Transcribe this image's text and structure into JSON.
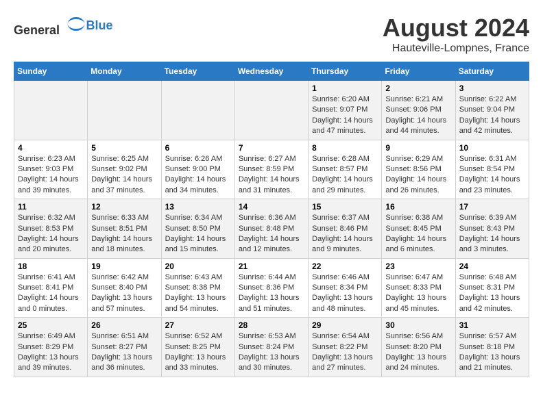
{
  "header": {
    "logo_general": "General",
    "logo_blue": "Blue",
    "month_year": "August 2024",
    "location": "Hauteville-Lompnes, France"
  },
  "days_of_week": [
    "Sunday",
    "Monday",
    "Tuesday",
    "Wednesday",
    "Thursday",
    "Friday",
    "Saturday"
  ],
  "weeks": [
    [
      {
        "day": "",
        "info": ""
      },
      {
        "day": "",
        "info": ""
      },
      {
        "day": "",
        "info": ""
      },
      {
        "day": "",
        "info": ""
      },
      {
        "day": "1",
        "info": "Sunrise: 6:20 AM\nSunset: 9:07 PM\nDaylight: 14 hours\nand 47 minutes."
      },
      {
        "day": "2",
        "info": "Sunrise: 6:21 AM\nSunset: 9:06 PM\nDaylight: 14 hours\nand 44 minutes."
      },
      {
        "day": "3",
        "info": "Sunrise: 6:22 AM\nSunset: 9:04 PM\nDaylight: 14 hours\nand 42 minutes."
      }
    ],
    [
      {
        "day": "4",
        "info": "Sunrise: 6:23 AM\nSunset: 9:03 PM\nDaylight: 14 hours\nand 39 minutes."
      },
      {
        "day": "5",
        "info": "Sunrise: 6:25 AM\nSunset: 9:02 PM\nDaylight: 14 hours\nand 37 minutes."
      },
      {
        "day": "6",
        "info": "Sunrise: 6:26 AM\nSunset: 9:00 PM\nDaylight: 14 hours\nand 34 minutes."
      },
      {
        "day": "7",
        "info": "Sunrise: 6:27 AM\nSunset: 8:59 PM\nDaylight: 14 hours\nand 31 minutes."
      },
      {
        "day": "8",
        "info": "Sunrise: 6:28 AM\nSunset: 8:57 PM\nDaylight: 14 hours\nand 29 minutes."
      },
      {
        "day": "9",
        "info": "Sunrise: 6:29 AM\nSunset: 8:56 PM\nDaylight: 14 hours\nand 26 minutes."
      },
      {
        "day": "10",
        "info": "Sunrise: 6:31 AM\nSunset: 8:54 PM\nDaylight: 14 hours\nand 23 minutes."
      }
    ],
    [
      {
        "day": "11",
        "info": "Sunrise: 6:32 AM\nSunset: 8:53 PM\nDaylight: 14 hours\nand 20 minutes."
      },
      {
        "day": "12",
        "info": "Sunrise: 6:33 AM\nSunset: 8:51 PM\nDaylight: 14 hours\nand 18 minutes."
      },
      {
        "day": "13",
        "info": "Sunrise: 6:34 AM\nSunset: 8:50 PM\nDaylight: 14 hours\nand 15 minutes."
      },
      {
        "day": "14",
        "info": "Sunrise: 6:36 AM\nSunset: 8:48 PM\nDaylight: 14 hours\nand 12 minutes."
      },
      {
        "day": "15",
        "info": "Sunrise: 6:37 AM\nSunset: 8:46 PM\nDaylight: 14 hours\nand 9 minutes."
      },
      {
        "day": "16",
        "info": "Sunrise: 6:38 AM\nSunset: 8:45 PM\nDaylight: 14 hours\nand 6 minutes."
      },
      {
        "day": "17",
        "info": "Sunrise: 6:39 AM\nSunset: 8:43 PM\nDaylight: 14 hours\nand 3 minutes."
      }
    ],
    [
      {
        "day": "18",
        "info": "Sunrise: 6:41 AM\nSunset: 8:41 PM\nDaylight: 14 hours\nand 0 minutes."
      },
      {
        "day": "19",
        "info": "Sunrise: 6:42 AM\nSunset: 8:40 PM\nDaylight: 13 hours\nand 57 minutes."
      },
      {
        "day": "20",
        "info": "Sunrise: 6:43 AM\nSunset: 8:38 PM\nDaylight: 13 hours\nand 54 minutes."
      },
      {
        "day": "21",
        "info": "Sunrise: 6:44 AM\nSunset: 8:36 PM\nDaylight: 13 hours\nand 51 minutes."
      },
      {
        "day": "22",
        "info": "Sunrise: 6:46 AM\nSunset: 8:34 PM\nDaylight: 13 hours\nand 48 minutes."
      },
      {
        "day": "23",
        "info": "Sunrise: 6:47 AM\nSunset: 8:33 PM\nDaylight: 13 hours\nand 45 minutes."
      },
      {
        "day": "24",
        "info": "Sunrise: 6:48 AM\nSunset: 8:31 PM\nDaylight: 13 hours\nand 42 minutes."
      }
    ],
    [
      {
        "day": "25",
        "info": "Sunrise: 6:49 AM\nSunset: 8:29 PM\nDaylight: 13 hours\nand 39 minutes."
      },
      {
        "day": "26",
        "info": "Sunrise: 6:51 AM\nSunset: 8:27 PM\nDaylight: 13 hours\nand 36 minutes."
      },
      {
        "day": "27",
        "info": "Sunrise: 6:52 AM\nSunset: 8:25 PM\nDaylight: 13 hours\nand 33 minutes."
      },
      {
        "day": "28",
        "info": "Sunrise: 6:53 AM\nSunset: 8:24 PM\nDaylight: 13 hours\nand 30 minutes."
      },
      {
        "day": "29",
        "info": "Sunrise: 6:54 AM\nSunset: 8:22 PM\nDaylight: 13 hours\nand 27 minutes."
      },
      {
        "day": "30",
        "info": "Sunrise: 6:56 AM\nSunset: 8:20 PM\nDaylight: 13 hours\nand 24 minutes."
      },
      {
        "day": "31",
        "info": "Sunrise: 6:57 AM\nSunset: 8:18 PM\nDaylight: 13 hours\nand 21 minutes."
      }
    ]
  ]
}
